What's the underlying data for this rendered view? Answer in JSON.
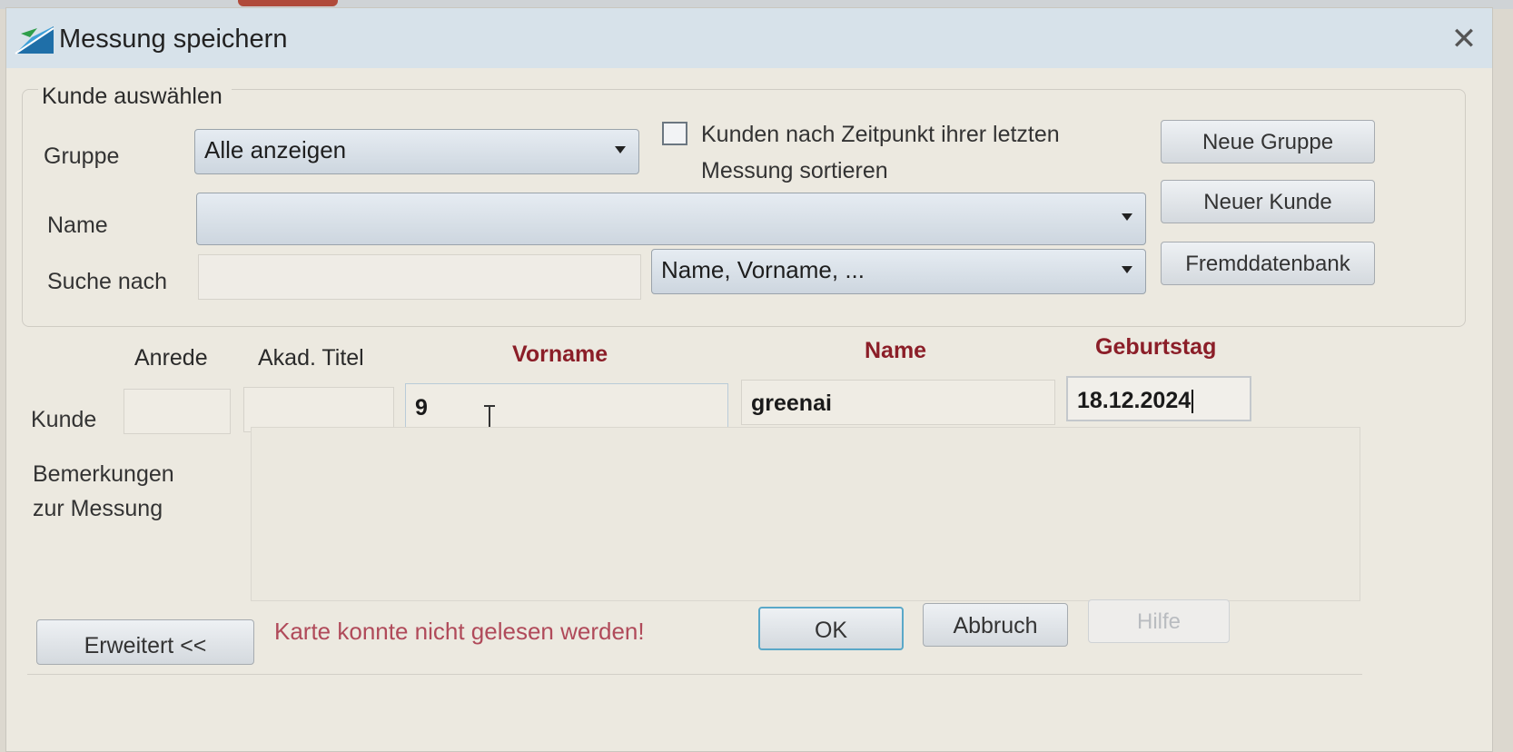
{
  "window": {
    "title": "Messung speichern",
    "close_symbol": "✕"
  },
  "group": {
    "legend": "Kunde auswählen",
    "gruppe_label": "Gruppe",
    "gruppe_value": "Alle anzeigen",
    "sort_checkbox_checked": false,
    "sort_label_line1": "Kunden nach Zeitpunkt ihrer letzten",
    "sort_label_line2": "Messung sortieren",
    "neue_gruppe": "Neue Gruppe",
    "name_label": "Name",
    "name_value": "",
    "neuer_kunde": "Neuer Kunde",
    "suche_label": "Suche nach",
    "suche_value": "",
    "suche_kriterium": "Name, Vorname, ...",
    "fremddatenbank": "Fremddatenbank"
  },
  "kunde": {
    "row_label": "Kunde",
    "headers": {
      "anrede": "Anrede",
      "titel": "Akad. Titel",
      "vorname": "Vorname",
      "name": "Name",
      "geburtstag": "Geburtstag"
    },
    "anrede": "",
    "titel": "",
    "vorname": "9",
    "name": "greenai",
    "geburtstag": "18.12.2024"
  },
  "bemerkungen": {
    "label_line1": "Bemerkungen",
    "label_line2": "zur Messung",
    "value": ""
  },
  "footer": {
    "erweitert": "Erweitert <<",
    "status": "Karte konnte nicht gelesen werden!",
    "ok": "OK",
    "abbruch": "Abbruch",
    "hilfe": "Hilfe"
  },
  "colors": {
    "required_label": "#8b1e28",
    "status_text": "#b04a5a",
    "titlebar": "#d7e2ea"
  }
}
